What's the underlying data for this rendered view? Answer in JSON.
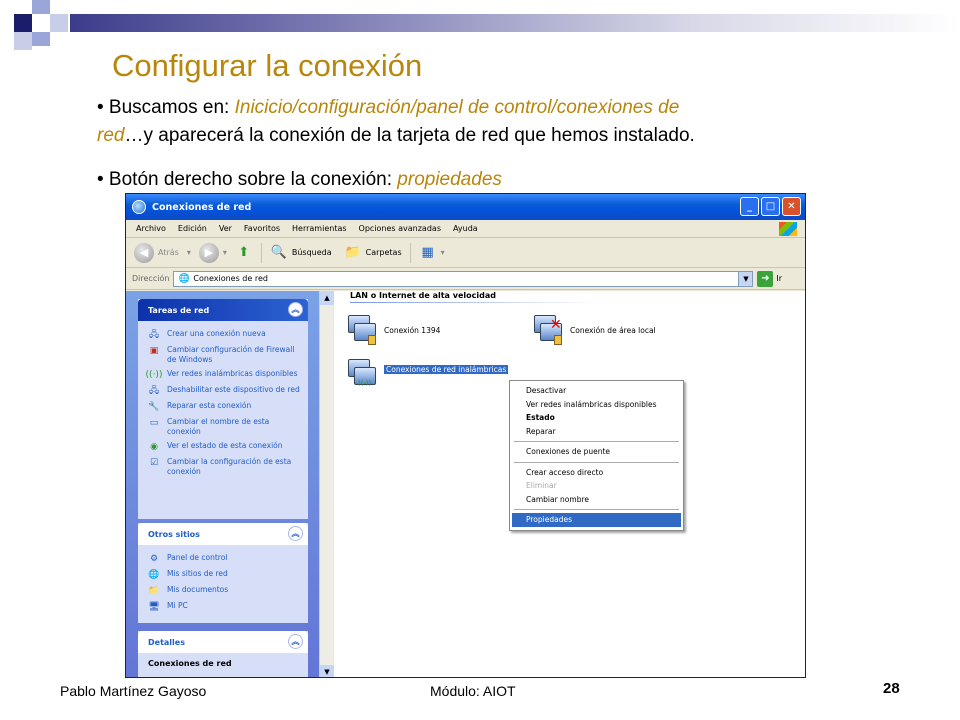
{
  "slide": {
    "title": "Configurar la conexión",
    "bullet1_prefix": "• Buscamos en: ",
    "bullet1_path": "Inicicio/configuración/panel de control/conexiones de",
    "bullet1_line2_path": "red",
    "bullet1_line2_rest": "…y aparecerá la conexión de la tarjeta de red que hemos instalado.",
    "bullet2_prefix": "• Botón derecho sobre la conexión: ",
    "bullet2_hl": "propiedades",
    "footer_author": "Pablo Martínez Gayoso",
    "footer_module": "Módulo: AIOT",
    "page_number": "28",
    "accent_color": "#b8860b"
  },
  "window": {
    "title": "Conexiones de red",
    "menu": [
      "Archivo",
      "Edición",
      "Ver",
      "Favoritos",
      "Herramientas",
      "Opciones avanzadas",
      "Ayuda"
    ],
    "toolbar": {
      "back": "Atrás",
      "search": "Búsqueda",
      "folders": "Carpetas"
    },
    "address": {
      "label": "Dirección",
      "value": "Conexiones de red",
      "go": "Ir"
    },
    "left_panels": {
      "tasks": {
        "title": "Tareas de red",
        "items": [
          "Crear una conexión nueva",
          "Cambiar configuración de Firewall de Windows",
          "Ver redes inalámbricas disponibles",
          "Deshabilitar este dispositivo de red",
          "Reparar esta conexión",
          "Cambiar el nombre de esta conexión",
          "Ver el estado de esta conexión",
          "Cambiar la configuración de esta conexión"
        ]
      },
      "other": {
        "title": "Otros sitios",
        "items": [
          "Panel de control",
          "Mis sitios de red",
          "Mis documentos",
          "Mi PC"
        ]
      },
      "details": {
        "title": "Detalles",
        "subtitle": "Conexiones de red"
      }
    },
    "main": {
      "group": "LAN o Internet de alta velocidad",
      "connections": [
        "Conexión 1394",
        "Conexión de área local",
        "Conexiones de red inalámbricas"
      ]
    },
    "context_menu": {
      "items": [
        {
          "label": "Desactivar",
          "style": "normal"
        },
        {
          "label": "Ver redes inalámbricas disponibles",
          "style": "normal"
        },
        {
          "label": "Estado",
          "style": "bold"
        },
        {
          "label": "Reparar",
          "style": "normal"
        },
        {
          "label": "Conexiones de puente",
          "style": "normal"
        },
        {
          "label": "Crear acceso directo",
          "style": "normal"
        },
        {
          "label": "Eliminar",
          "style": "disabled"
        },
        {
          "label": "Cambiar nombre",
          "style": "normal"
        },
        {
          "label": "Propiedades",
          "style": "highlighted"
        }
      ]
    }
  }
}
